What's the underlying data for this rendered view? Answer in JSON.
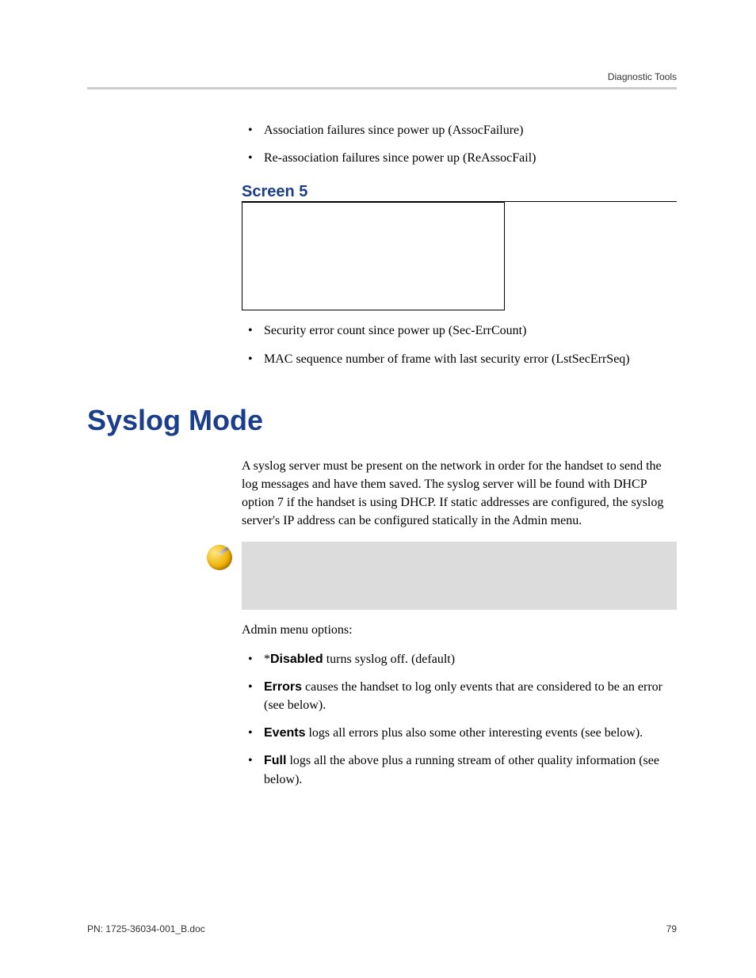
{
  "header": {
    "section_title": "Diagnostic Tools"
  },
  "top_bullets": [
    "Association failures since power up (AssocFailure)",
    "Re-association failures since power up (ReAssocFail)"
  ],
  "screen5": {
    "heading": "Screen 5",
    "bullets": [
      "Security error count since power up (Sec-ErrCount)",
      "MAC sequence number of frame with last security error (LstSecErrSeq)"
    ]
  },
  "syslog": {
    "heading": "Syslog Mode",
    "intro": "A syslog server must be present on the network in order for the handset to send the log messages and have them saved. The syslog server will be found with DHCP option 7 if the handset is using DHCP. If static addresses are configured, the syslog server's IP address can be configured statically in the Admin menu.",
    "admin_label": "Admin menu options:",
    "options": [
      {
        "prefix": "*",
        "name": "Disabled",
        "rest": " turns syslog off.  (default)"
      },
      {
        "prefix": "",
        "name": "Errors",
        "rest": " causes the handset to log only events that are considered to be an error (see below)."
      },
      {
        "prefix": "",
        "name": "Events",
        "rest": " logs all errors plus also some other interesting events (see below)."
      },
      {
        "prefix": "",
        "name": "Full",
        "rest": " logs all the above plus a running stream of other quality information (see below)."
      }
    ]
  },
  "footer": {
    "left": "PN: 1725-36034-001_B.doc",
    "right": "79"
  }
}
